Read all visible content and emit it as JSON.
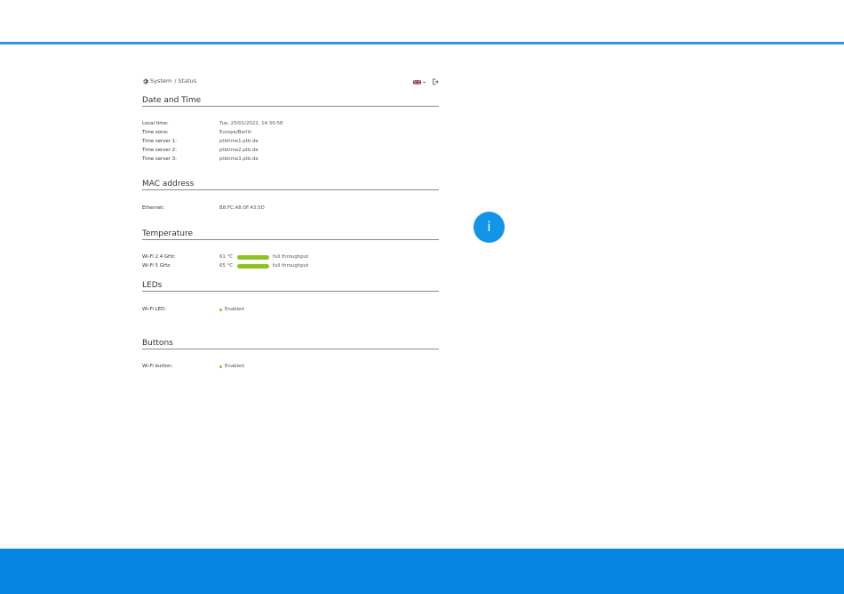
{
  "breadcrumb": {
    "section": "System",
    "separator": "/",
    "page": "Status"
  },
  "icons": {
    "breadcrumb": "gear-icon",
    "language": "uk-flag-icon",
    "logout": "logout-icon",
    "info": "info-icon"
  },
  "colors": {
    "accent": "#0584e3",
    "top_line": "#2f95df",
    "status_green": "#8fc31f"
  },
  "date_time": {
    "title": "Date and Time",
    "rows": [
      {
        "label": "Local time:",
        "value": "Tue, 25/01/2022, 14:30:58"
      },
      {
        "label": "Time zone:",
        "value": "Europe/Berlin"
      },
      {
        "label": "Time server 1:",
        "value": "ptbtime1.ptb.de"
      },
      {
        "label": "Time server 2:",
        "value": "ptbtime2.ptb.de"
      },
      {
        "label": "Time server 3:",
        "value": "ptbtime3.ptb.de"
      }
    ]
  },
  "mac": {
    "title": "MAC address",
    "rows": [
      {
        "label": "Ethernet:",
        "value": "B8:FC:A8:0F:43:5D"
      }
    ]
  },
  "temperature": {
    "title": "Temperature",
    "rows": [
      {
        "label": "Wi-Fi 2.4 GHz:",
        "temp": "61 °C",
        "status": "full throughput"
      },
      {
        "label": "Wi-Fi 5 GHz:",
        "temp": "65 °C",
        "status": "full throughput"
      }
    ]
  },
  "leds": {
    "title": "LEDs",
    "rows": [
      {
        "label": "Wi-Fi LED:",
        "value": "Enabled"
      }
    ]
  },
  "buttons": {
    "title": "Buttons",
    "rows": [
      {
        "label": "Wi-Fi button:",
        "value": "Enabled"
      }
    ]
  },
  "info": {
    "glyph": "i"
  }
}
